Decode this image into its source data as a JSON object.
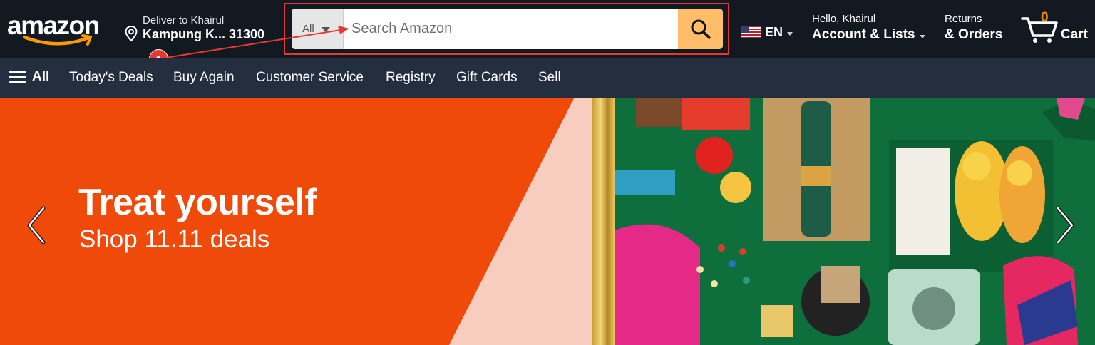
{
  "header": {
    "logo_text": "amazon",
    "deliver": {
      "line1": "Deliver to Khairul",
      "line2": "Kampung K... 31300"
    },
    "search": {
      "category": "All",
      "placeholder": "Search Amazon",
      "value": ""
    },
    "language": "EN",
    "account": {
      "line1": "Hello, Khairul",
      "line2": "Account & Lists"
    },
    "orders": {
      "line1": "Returns",
      "line2": "& Orders"
    },
    "cart": {
      "count": "0",
      "label": "Cart"
    }
  },
  "annotation": {
    "badge": "1",
    "color": "#e53935"
  },
  "subnav": {
    "all_label": "All",
    "items": [
      "Today's Deals",
      "Buy Again",
      "Customer Service",
      "Registry",
      "Gift Cards",
      "Sell"
    ]
  },
  "hero": {
    "title": "Treat yourself",
    "subtitle": "Shop 11.11 deals"
  },
  "colors": {
    "nav_dark": "#131921",
    "nav_secondary": "#232f3e",
    "search_button": "#febd69",
    "cart_count": "#f08804",
    "hero_orange": "#f04a0a",
    "hero_pink": "#f7cdbf",
    "hero_green": "#0e6e3c"
  },
  "icons": [
    "location-pin-icon",
    "caret-down-icon",
    "search-icon",
    "us-flag-icon",
    "cart-icon",
    "hamburger-menu-icon",
    "chevron-left-icon",
    "chevron-right-icon"
  ]
}
